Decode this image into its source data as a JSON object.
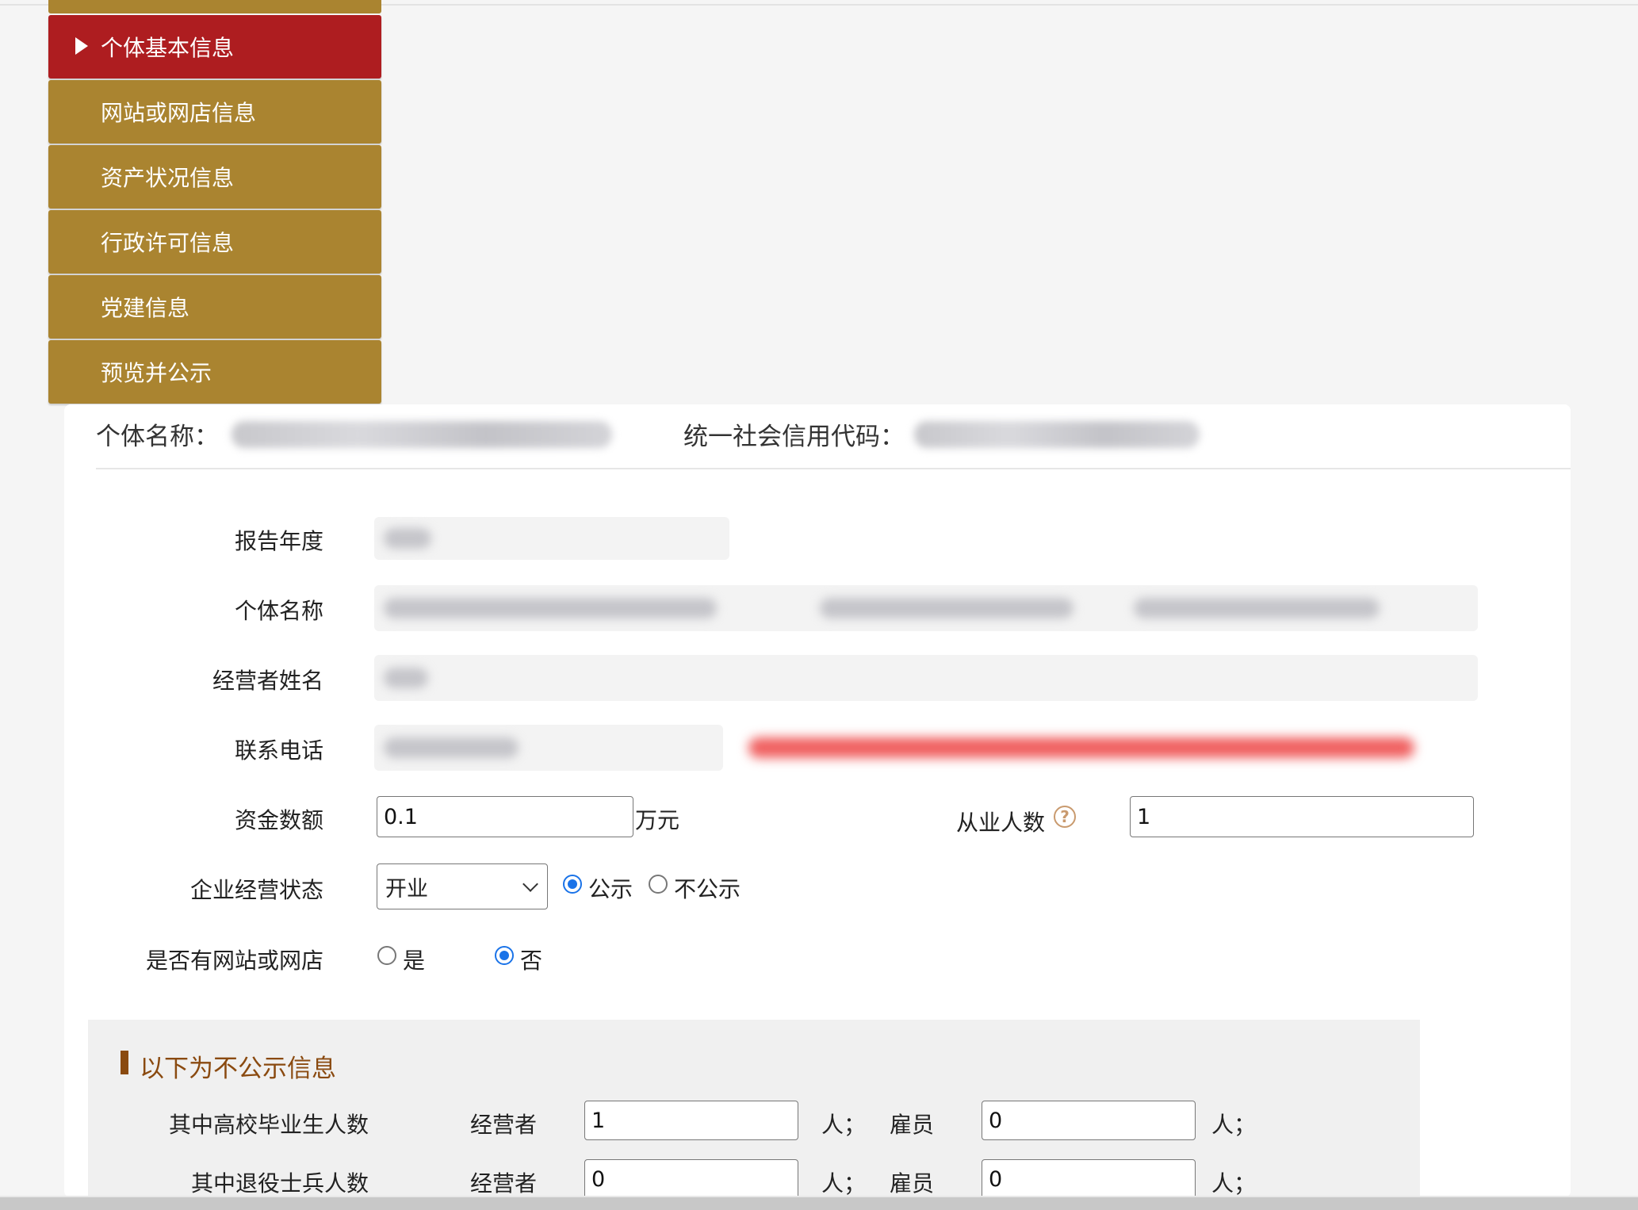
{
  "sidebar": {
    "items": [
      {
        "label": "个体基本信息",
        "active": true
      },
      {
        "label": "网站或网店信息",
        "active": false
      },
      {
        "label": "资产状况信息",
        "active": false
      },
      {
        "label": "行政许可信息",
        "active": false
      },
      {
        "label": "党建信息",
        "active": false
      },
      {
        "label": "预览并公示",
        "active": false
      }
    ]
  },
  "header": {
    "name_label": "个体名称：",
    "credit_label": "统一社会信用代码："
  },
  "form": {
    "report_year_label": "报告年度",
    "entity_name_label": "个体名称",
    "operator_name_label": "经营者姓名",
    "phone_label": "联系电话",
    "capital_label": "资金数额",
    "capital_value": "0.1",
    "capital_unit": "万元",
    "employees_label": "从业人数",
    "employees_value": "1",
    "status_label": "企业经营状态",
    "status_selected": "开业",
    "public_option": "公示",
    "nonpublic_option": "不公示",
    "website_label": "是否有网站或网店",
    "website_yes": "是",
    "website_no": "否"
  },
  "private_section": {
    "title": "以下为不公示信息",
    "rows": [
      {
        "label": "其中高校毕业生人数",
        "operator_label": "经营者",
        "operator_value": "1",
        "unit1": "人；",
        "employee_label": "雇员",
        "employee_value": "0",
        "unit2": "人；"
      },
      {
        "label": "其中退役士兵人数",
        "operator_label": "经营者",
        "operator_value": "0",
        "unit1": "人；",
        "employee_label": "雇员",
        "employee_value": "0",
        "unit2": "人；"
      }
    ]
  },
  "colors": {
    "sidebar_gold": "#aa8430",
    "sidebar_active": "#ae1d20",
    "section_title": "#8a4a10",
    "radio_blue": "#1a73e8"
  }
}
